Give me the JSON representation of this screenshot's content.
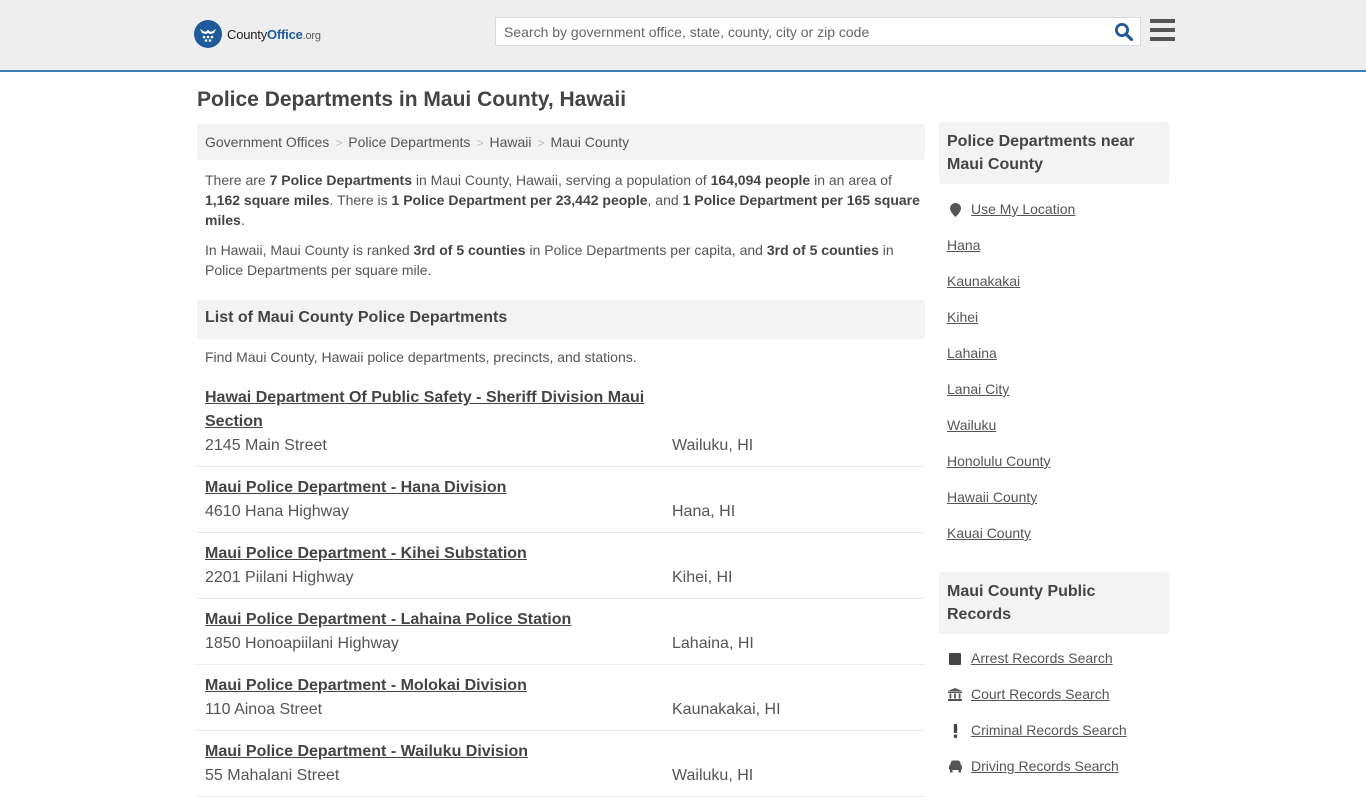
{
  "header": {
    "logo": {
      "county": "County",
      "office": "Office",
      "tld": ".org"
    },
    "search_placeholder": "Search by government office, state, county, city or zip code",
    "colors": {
      "brand": "#1f5a9a",
      "header_bg": "#eeeeee",
      "header_border": "#3a7cb0"
    }
  },
  "page": {
    "title": "Police Departments in Maui County, Hawaii",
    "breadcrumb": [
      "Government Offices",
      "Police Departments",
      "Hawaii",
      "Maui County"
    ],
    "intro": {
      "p1": {
        "t1": "There are ",
        "b1": "7 Police Departments",
        "t2": " in Maui County, Hawaii, serving a population of ",
        "b2": "164,094 people",
        "t3": " in an area of ",
        "b3": "1,162 square miles",
        "t4": ". There is ",
        "b4": "1 Police Department per 23,442 people",
        "t5": ", and ",
        "b5": "1 Police Department per 165 square miles",
        "t6": "."
      },
      "p2": {
        "t1": "In Hawaii, Maui County is ranked ",
        "b1": "3rd of 5 counties",
        "t2": " in Police Departments per capita, and ",
        "b2": "3rd of 5 counties",
        "t3": " in Police Departments per square mile."
      }
    },
    "list_heading": "List of Maui County Police Departments",
    "list_desc": "Find Maui County, Hawaii police departments, precincts, and stations.",
    "departments": [
      {
        "name": "Hawai Department Of Public Safety - Sheriff Division Maui Section",
        "address": "2145 Main Street",
        "city": "Wailuku, HI"
      },
      {
        "name": "Maui Police Department - Hana Division",
        "address": "4610 Hana Highway",
        "city": "Hana, HI"
      },
      {
        "name": "Maui Police Department - Kihei Substation",
        "address": "2201 Piilani Highway",
        "city": "Kihei, HI"
      },
      {
        "name": "Maui Police Department - Lahaina Police Station",
        "address": "1850 Honoapiilani Highway",
        "city": "Lahaina, HI"
      },
      {
        "name": "Maui Police Department - Molokai Division",
        "address": "110 Ainoa Street",
        "city": "Kaunakakai, HI"
      },
      {
        "name": "Maui Police Department - Wailuku Division",
        "address": "55 Mahalani Street",
        "city": "Wailuku, HI"
      }
    ]
  },
  "sidebar": {
    "nearby": {
      "heading": "Police Departments near Maui County",
      "use_location": "Use My Location",
      "links": [
        "Hana",
        "Kaunakakai",
        "Kihei",
        "Lahaina",
        "Lanai City",
        "Wailuku",
        "Honolulu County",
        "Hawaii County",
        "Kauai County"
      ]
    },
    "records": {
      "heading": "Maui County Public Records",
      "links": [
        {
          "label": "Arrest Records Search",
          "icon": "square-icon"
        },
        {
          "label": "Court Records Search",
          "icon": "courthouse-icon"
        },
        {
          "label": "Criminal Records Search",
          "icon": "exclamation-icon"
        },
        {
          "label": "Driving Records Search",
          "icon": "car-icon"
        }
      ]
    }
  }
}
